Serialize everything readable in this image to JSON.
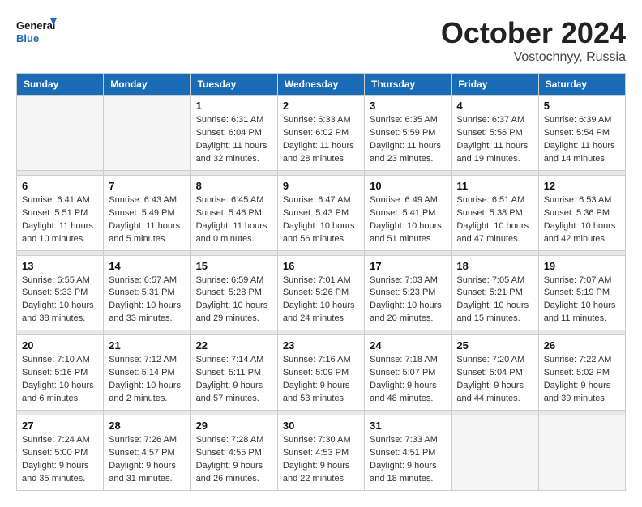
{
  "logo": {
    "line1": "General",
    "line2": "Blue"
  },
  "title": "October 2024",
  "subtitle": "Vostochnyy, Russia",
  "days_of_week": [
    "Sunday",
    "Monday",
    "Tuesday",
    "Wednesday",
    "Thursday",
    "Friday",
    "Saturday"
  ],
  "weeks": [
    [
      {
        "num": "",
        "detail": ""
      },
      {
        "num": "",
        "detail": ""
      },
      {
        "num": "1",
        "detail": "Sunrise: 6:31 AM\nSunset: 6:04 PM\nDaylight: 11 hours and 32 minutes."
      },
      {
        "num": "2",
        "detail": "Sunrise: 6:33 AM\nSunset: 6:02 PM\nDaylight: 11 hours and 28 minutes."
      },
      {
        "num": "3",
        "detail": "Sunrise: 6:35 AM\nSunset: 5:59 PM\nDaylight: 11 hours and 23 minutes."
      },
      {
        "num": "4",
        "detail": "Sunrise: 6:37 AM\nSunset: 5:56 PM\nDaylight: 11 hours and 19 minutes."
      },
      {
        "num": "5",
        "detail": "Sunrise: 6:39 AM\nSunset: 5:54 PM\nDaylight: 11 hours and 14 minutes."
      }
    ],
    [
      {
        "num": "6",
        "detail": "Sunrise: 6:41 AM\nSunset: 5:51 PM\nDaylight: 11 hours and 10 minutes."
      },
      {
        "num": "7",
        "detail": "Sunrise: 6:43 AM\nSunset: 5:49 PM\nDaylight: 11 hours and 5 minutes."
      },
      {
        "num": "8",
        "detail": "Sunrise: 6:45 AM\nSunset: 5:46 PM\nDaylight: 11 hours and 0 minutes."
      },
      {
        "num": "9",
        "detail": "Sunrise: 6:47 AM\nSunset: 5:43 PM\nDaylight: 10 hours and 56 minutes."
      },
      {
        "num": "10",
        "detail": "Sunrise: 6:49 AM\nSunset: 5:41 PM\nDaylight: 10 hours and 51 minutes."
      },
      {
        "num": "11",
        "detail": "Sunrise: 6:51 AM\nSunset: 5:38 PM\nDaylight: 10 hours and 47 minutes."
      },
      {
        "num": "12",
        "detail": "Sunrise: 6:53 AM\nSunset: 5:36 PM\nDaylight: 10 hours and 42 minutes."
      }
    ],
    [
      {
        "num": "13",
        "detail": "Sunrise: 6:55 AM\nSunset: 5:33 PM\nDaylight: 10 hours and 38 minutes."
      },
      {
        "num": "14",
        "detail": "Sunrise: 6:57 AM\nSunset: 5:31 PM\nDaylight: 10 hours and 33 minutes."
      },
      {
        "num": "15",
        "detail": "Sunrise: 6:59 AM\nSunset: 5:28 PM\nDaylight: 10 hours and 29 minutes."
      },
      {
        "num": "16",
        "detail": "Sunrise: 7:01 AM\nSunset: 5:26 PM\nDaylight: 10 hours and 24 minutes."
      },
      {
        "num": "17",
        "detail": "Sunrise: 7:03 AM\nSunset: 5:23 PM\nDaylight: 10 hours and 20 minutes."
      },
      {
        "num": "18",
        "detail": "Sunrise: 7:05 AM\nSunset: 5:21 PM\nDaylight: 10 hours and 15 minutes."
      },
      {
        "num": "19",
        "detail": "Sunrise: 7:07 AM\nSunset: 5:19 PM\nDaylight: 10 hours and 11 minutes."
      }
    ],
    [
      {
        "num": "20",
        "detail": "Sunrise: 7:10 AM\nSunset: 5:16 PM\nDaylight: 10 hours and 6 minutes."
      },
      {
        "num": "21",
        "detail": "Sunrise: 7:12 AM\nSunset: 5:14 PM\nDaylight: 10 hours and 2 minutes."
      },
      {
        "num": "22",
        "detail": "Sunrise: 7:14 AM\nSunset: 5:11 PM\nDaylight: 9 hours and 57 minutes."
      },
      {
        "num": "23",
        "detail": "Sunrise: 7:16 AM\nSunset: 5:09 PM\nDaylight: 9 hours and 53 minutes."
      },
      {
        "num": "24",
        "detail": "Sunrise: 7:18 AM\nSunset: 5:07 PM\nDaylight: 9 hours and 48 minutes."
      },
      {
        "num": "25",
        "detail": "Sunrise: 7:20 AM\nSunset: 5:04 PM\nDaylight: 9 hours and 44 minutes."
      },
      {
        "num": "26",
        "detail": "Sunrise: 7:22 AM\nSunset: 5:02 PM\nDaylight: 9 hours and 39 minutes."
      }
    ],
    [
      {
        "num": "27",
        "detail": "Sunrise: 7:24 AM\nSunset: 5:00 PM\nDaylight: 9 hours and 35 minutes."
      },
      {
        "num": "28",
        "detail": "Sunrise: 7:26 AM\nSunset: 4:57 PM\nDaylight: 9 hours and 31 minutes."
      },
      {
        "num": "29",
        "detail": "Sunrise: 7:28 AM\nSunset: 4:55 PM\nDaylight: 9 hours and 26 minutes."
      },
      {
        "num": "30",
        "detail": "Sunrise: 7:30 AM\nSunset: 4:53 PM\nDaylight: 9 hours and 22 minutes."
      },
      {
        "num": "31",
        "detail": "Sunrise: 7:33 AM\nSunset: 4:51 PM\nDaylight: 9 hours and 18 minutes."
      },
      {
        "num": "",
        "detail": ""
      },
      {
        "num": "",
        "detail": ""
      }
    ]
  ]
}
